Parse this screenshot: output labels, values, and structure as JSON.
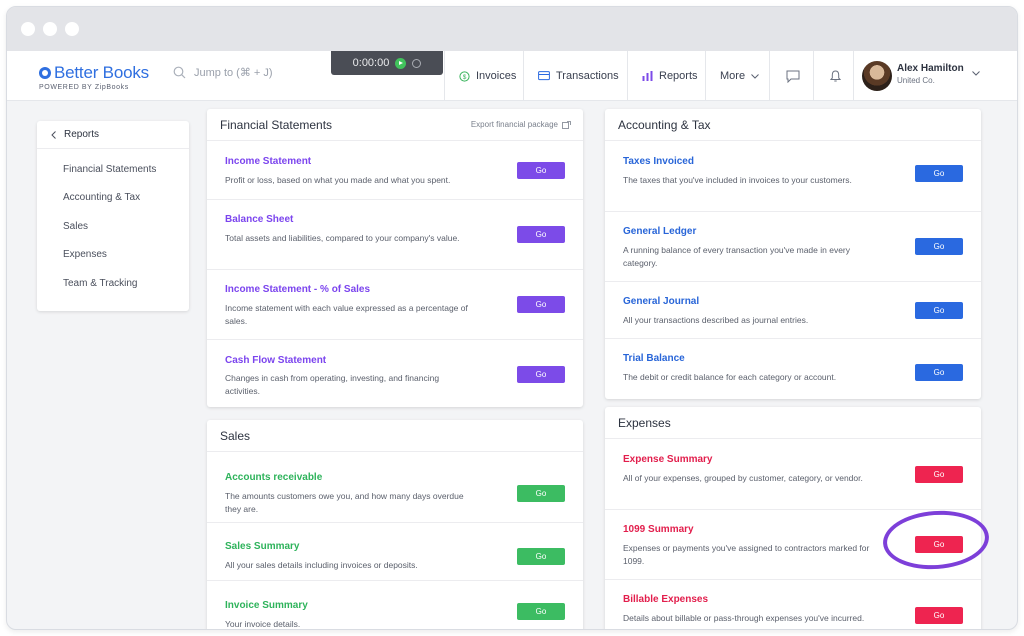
{
  "app": {
    "logo_text": "Better Books",
    "logo_sub": "POWERED BY  ZipBooks",
    "search_placeholder": "Jump to (⌘ + J)",
    "timer": "0:00:00"
  },
  "nav": {
    "invoices": "Invoices",
    "transactions": "Transactions",
    "reports": "Reports",
    "more": "More"
  },
  "user": {
    "name": "Alex Hamilton",
    "company": "United Co."
  },
  "sidebar": {
    "header": "Reports",
    "items": [
      "Financial Statements",
      "Accounting & Tax",
      "Sales",
      "Expenses",
      "Team & Tracking"
    ]
  },
  "go_label": "Go",
  "financial": {
    "title": "Financial Statements",
    "export": "Export financial package",
    "rows": [
      {
        "title": "Income Statement",
        "desc": "Profit or loss, based on what you made and what you spent."
      },
      {
        "title": "Balance Sheet",
        "desc": "Total assets and liabilities, compared to your company's value."
      },
      {
        "title": "Income Statement - % of Sales",
        "desc": "Income statement with each value expressed as a percentage of sales."
      },
      {
        "title": "Cash Flow Statement",
        "desc": "Changes in cash from operating, investing, and financing activities."
      }
    ]
  },
  "sales": {
    "title": "Sales",
    "rows": [
      {
        "title": "Accounts receivable",
        "desc": "The amounts customers owe you, and how many days overdue they are."
      },
      {
        "title": "Sales Summary",
        "desc": "All your sales details including invoices or deposits."
      },
      {
        "title": "Invoice Summary",
        "desc": "Your invoice details."
      }
    ]
  },
  "accounting": {
    "title": "Accounting & Tax",
    "rows": [
      {
        "title": "Taxes Invoiced",
        "desc": "The taxes that you've included in invoices to your customers."
      },
      {
        "title": "General Ledger",
        "desc": "A running balance of every transaction you've made in every category."
      },
      {
        "title": "General Journal",
        "desc": "All your transactions described as journal entries."
      },
      {
        "title": "Trial Balance",
        "desc": "The debit or credit balance for each category or account."
      }
    ]
  },
  "expenses": {
    "title": "Expenses",
    "rows": [
      {
        "title": "Expense Summary",
        "desc": "All of your expenses, grouped by customer, category, or vendor."
      },
      {
        "title": "1099 Summary",
        "desc": "Expenses or payments you've assigned to contractors marked for 1099."
      },
      {
        "title": "Billable Expenses",
        "desc": "Details about billable or pass-through expenses you've incurred."
      }
    ]
  },
  "colors": {
    "purple": "#7c4be8",
    "green": "#3cbc62",
    "blue": "#2a69e0",
    "red": "#ee2450",
    "highlight": "#7d3fd9"
  }
}
